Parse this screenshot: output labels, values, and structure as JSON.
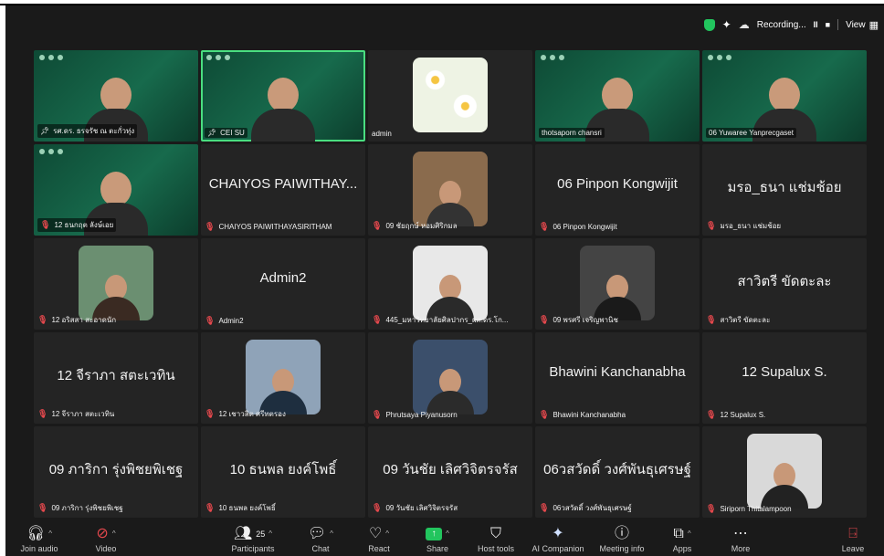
{
  "topbar": {
    "recording_label": "Recording...",
    "pause_label": "II",
    "stop_label": "■",
    "view_label": "View"
  },
  "tiles": [
    {
      "name": "รศ.ดร. ธรจรัช ณ ตะกั่วทุ่ง",
      "video": true,
      "pinned": true,
      "muted": false
    },
    {
      "name": "CEI SU",
      "video": true,
      "pinned": true,
      "muted": false,
      "active": true
    },
    {
      "name": "admin",
      "video": false,
      "avatar": "flowers"
    },
    {
      "name": "thotsaporn chansri",
      "video": true
    },
    {
      "name": "06 Yuwaree Yanprecgaset",
      "video": true
    },
    {
      "name": "12 ธนกฤต ลังษ์เอย",
      "video": true,
      "muted": true
    },
    {
      "name": "CHAIYOS PAIWITHAYASIRITHAM",
      "display": "CHAIYOS PAIWITHAY...",
      "muted": true
    },
    {
      "name": "09 ชัยฤกษ์ หอมศิริกมล",
      "avatar": "selfie",
      "muted": true
    },
    {
      "name": "06 Pinpon Kongwijit",
      "display": "06 Pinpon Kongwijit",
      "muted": true
    },
    {
      "name": "มรอ_ธนา แช่มช้อย",
      "display": "มรอ_ธนา แช่มช้อย",
      "muted": true
    },
    {
      "name": "12 อริสสา สะอาดนัก",
      "avatar": "woman1",
      "muted": true
    },
    {
      "name": "Admin2",
      "display": "Admin2",
      "muted": true
    },
    {
      "name": "445_มหาวิทยาลัยศิลปากร_ผศ.ดร.โก...",
      "avatar": "man1",
      "muted": true
    },
    {
      "name": "09 พรศรี เจริญพานิช",
      "avatar": "woman2",
      "muted": true
    },
    {
      "name": "สาวิตรี ขัดตะละ",
      "display": "สาวิตรี ขัดตะละ",
      "muted": true
    },
    {
      "name": "12 จีราภา สตะเวทิน",
      "display": "12 จีราภา สตะเวทิน",
      "muted": true
    },
    {
      "name": "12 เชาวลิต ศรีทตรอง",
      "avatar": "bridge",
      "muted": true
    },
    {
      "name": "Phrutsaya Piyanusorn",
      "avatar": "office",
      "muted": true
    },
    {
      "name": "Bhawini Kanchanabha",
      "display": "Bhawini Kanchanabha",
      "muted": true
    },
    {
      "name": "12 Supalux S.",
      "display": "12 Supalux S.",
      "muted": true
    },
    {
      "name": "09 ภาริกา รุ่งพิชยพิเชฐ",
      "display": "09 ภาริกา รุ่งพิชยพิเชฐ",
      "muted": true
    },
    {
      "name": "10 ธนพล ยงค์โพธิ์",
      "display": "10 ธนพล ยงค์โพธิ์",
      "muted": true
    },
    {
      "name": "09 วันชัย เลิศวิจิตรจรัส",
      "display": "09 วันชัย เลิศวิจิตรจรัส",
      "muted": true
    },
    {
      "name": "06วสวัดดิ์ วงศ์พันธุเศรษฐ์",
      "display": "06วสวัดดิ์ วงศ์พันธุเศรษฐ์",
      "muted": true
    },
    {
      "name": "Siriporn Thitalampoon",
      "avatar": "desk",
      "muted": true
    }
  ],
  "toolbar": {
    "join_audio": "Join audio",
    "video": "Video",
    "participants": "Participants",
    "participants_count": "25",
    "chat": "Chat",
    "react": "React",
    "share": "Share",
    "host_tools": "Host tools",
    "ai_companion": "AI Companion",
    "meeting_info": "Meeting info",
    "apps": "Apps",
    "more": "More",
    "leave": "Leave"
  }
}
